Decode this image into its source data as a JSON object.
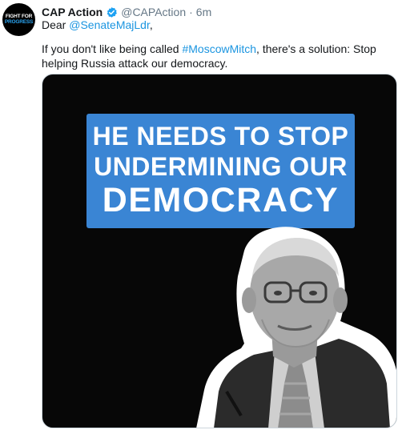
{
  "tweet": {
    "avatar": {
      "line1": "FIGHT FOR",
      "line2": "PROGRESS"
    },
    "display_name": "CAP Action",
    "handle": "@CAPAction",
    "separator": "·",
    "timestamp": "6m",
    "greeting": "Dear",
    "mention": "@SenateMajLdr",
    "greeting_punct": ",",
    "body_prefix": "If you don't like being called",
    "hashtag": "#MoscowMitch",
    "body_suffix": ", there's a solution: Stop helping Russia attack our democracy."
  },
  "media": {
    "banner_line1": "HE NEEDS TO STOP",
    "banner_line2": "UNDERMINING OUR",
    "banner_line3": "DEMOCRACY"
  },
  "colors": {
    "link": "#1b95e0",
    "verified": "#1da1f2",
    "banner": "#3a85d4",
    "media_bg": "#070707"
  },
  "icons": [
    "verified-badge-icon"
  ]
}
